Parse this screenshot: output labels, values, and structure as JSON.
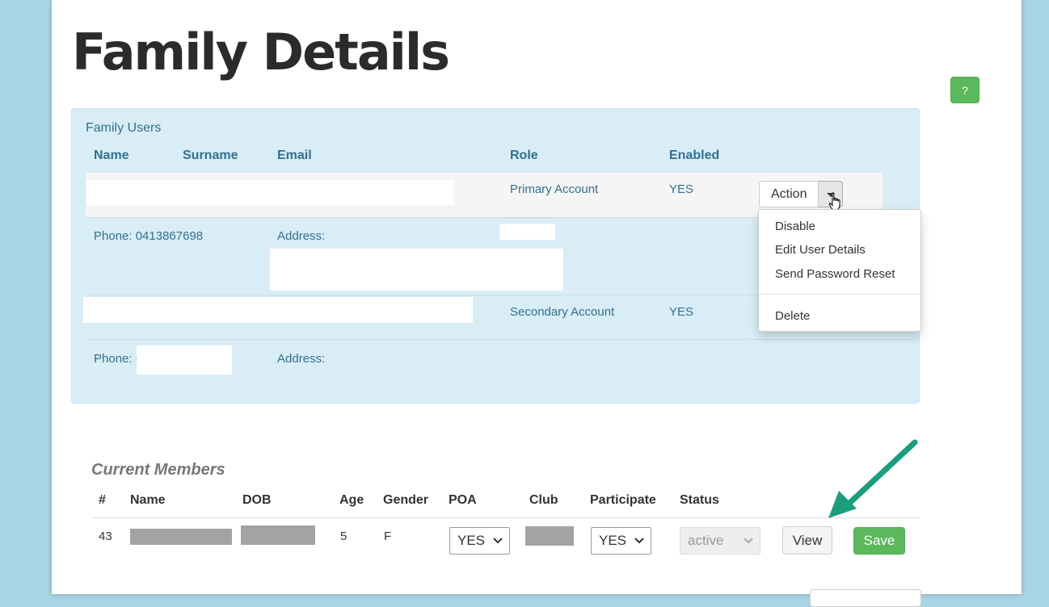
{
  "page": {
    "title": "Family Details",
    "help_label": "?"
  },
  "family_users": {
    "panel_title": "Family Users",
    "headers": {
      "name": "Name",
      "surname": "Surname",
      "email": "Email",
      "role": "Role",
      "enabled": "Enabled"
    },
    "users": [
      {
        "role": "Primary Account",
        "enabled": "YES",
        "phone_label": "Phone:",
        "phone": "0413867698",
        "address_label": "Address:"
      },
      {
        "role": "Secondary Account",
        "enabled": "YES",
        "phone_label": "Phone:",
        "phone_partial": "(",
        "address_label": "Address:"
      }
    ],
    "action_label": "Action",
    "action_menu": [
      "Disable",
      "Edit User Details",
      "Send Password Reset",
      "Delete"
    ]
  },
  "current_members": {
    "title": "Current Members",
    "headers": [
      "#",
      "Name",
      "DOB",
      "Age",
      "Gender",
      "POA",
      "Club",
      "Participate",
      "Status"
    ],
    "rows": [
      {
        "id": "43",
        "age": "5",
        "gender": "F",
        "poa": "YES",
        "participate": "YES",
        "status": "active"
      }
    ],
    "view_label": "View",
    "save_label": "Save"
  },
  "colors": {
    "accent_green": "#5cb85c",
    "panel_bg": "#d9edf7",
    "panel_text": "#31708f",
    "annotation_arrow": "#1a9e7e"
  }
}
